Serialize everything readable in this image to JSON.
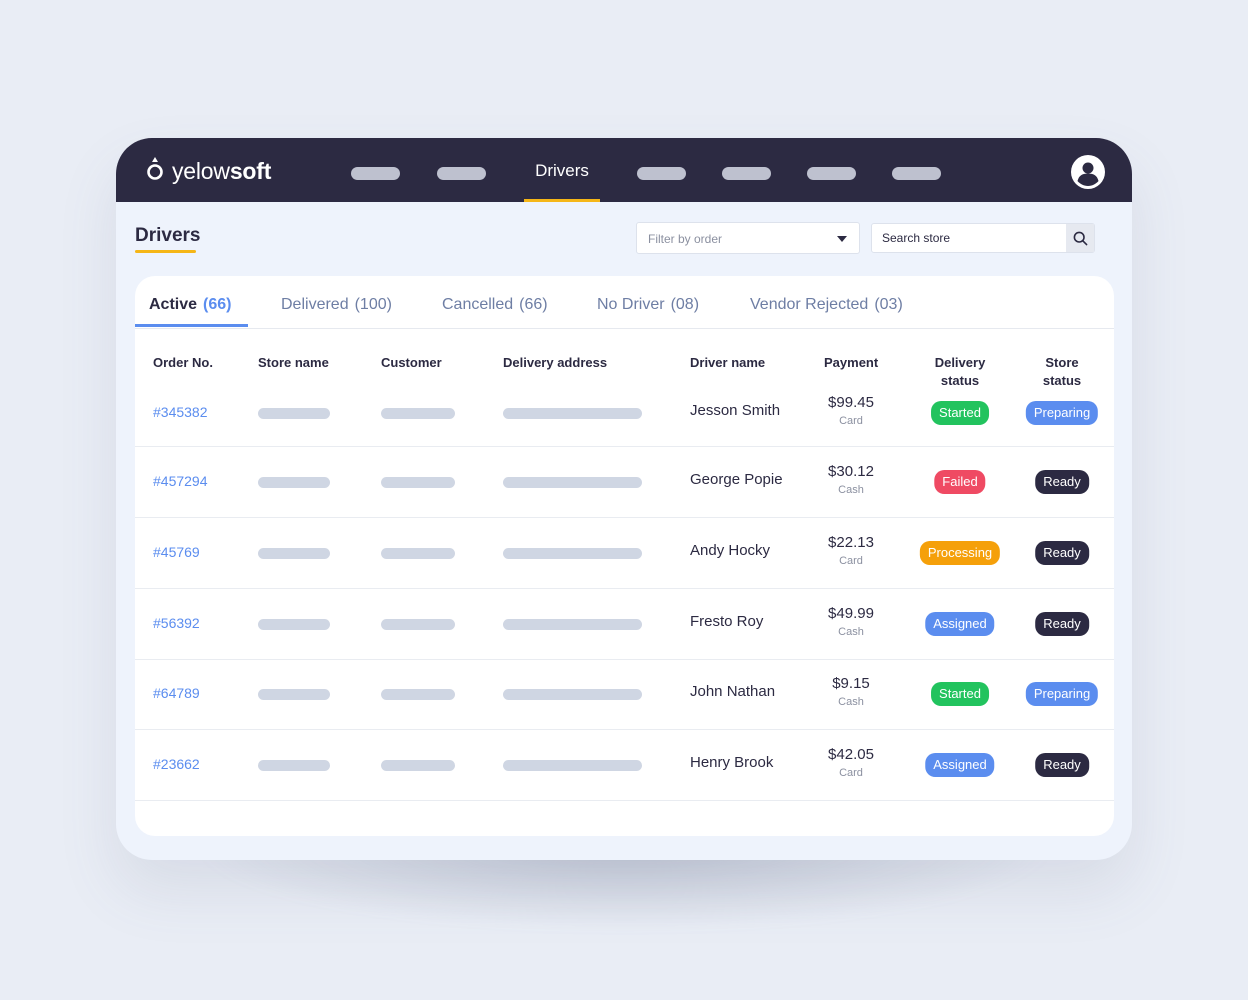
{
  "app": {
    "brand_light": "yelow",
    "brand_bold": "soft",
    "nav_active": "Drivers"
  },
  "page": {
    "title": "Drivers",
    "filter_label": "Filter by order",
    "search_placeholder": "Search store"
  },
  "tabs": [
    {
      "label": "Active",
      "count": "(66)"
    },
    {
      "label": "Delivered",
      "count": "(100)"
    },
    {
      "label": "Cancelled",
      "count": "(66)"
    },
    {
      "label": "No Driver",
      "count": "(08)"
    },
    {
      "label": "Vendor Rejected",
      "count": "(03)"
    }
  ],
  "columns": {
    "order": "Order No.",
    "store": "Store name",
    "customer": "Customer",
    "address": "Delivery address",
    "driver": "Driver name",
    "payment": "Payment",
    "delivery_1": "Delivery",
    "delivery_2": "status",
    "store_status_1": "Store",
    "store_status_2": "status"
  },
  "rows": [
    {
      "order": "#345382",
      "driver": "Jesson Smith",
      "amount": "$99.45",
      "method": "Card",
      "delivery": "Started",
      "store": "Preparing"
    },
    {
      "order": "#457294",
      "driver": "George Popie",
      "amount": "$30.12",
      "method": "Cash",
      "delivery": "Failed",
      "store": "Ready"
    },
    {
      "order": "#45769",
      "driver": "Andy Hocky",
      "amount": "$22.13",
      "method": "Card",
      "delivery": "Processing",
      "store": "Ready"
    },
    {
      "order": "#56392",
      "driver": "Fresto Roy",
      "amount": "$49.99",
      "method": "Cash",
      "delivery": "Assigned",
      "store": "Ready"
    },
    {
      "order": "#64789",
      "driver": "John Nathan",
      "amount": "$9.15",
      "method": "Cash",
      "delivery": "Started",
      "store": "Preparing"
    },
    {
      "order": "#23662",
      "driver": "Henry Brook",
      "amount": "$42.05",
      "method": "Card",
      "delivery": "Assigned",
      "store": "Ready"
    }
  ],
  "colors": {
    "navbar": "#2c2a42",
    "accent_yellow": "#f5b617",
    "link_blue": "#5b8def",
    "started": "#22c35e",
    "failed": "#ef4a63",
    "processing": "#f5a00a",
    "ready": "#2c2a42"
  },
  "icons": {
    "logo": "drop-logo-icon",
    "avatar": "user-avatar-icon",
    "search": "search-icon",
    "dropdown": "caret-down-icon"
  }
}
